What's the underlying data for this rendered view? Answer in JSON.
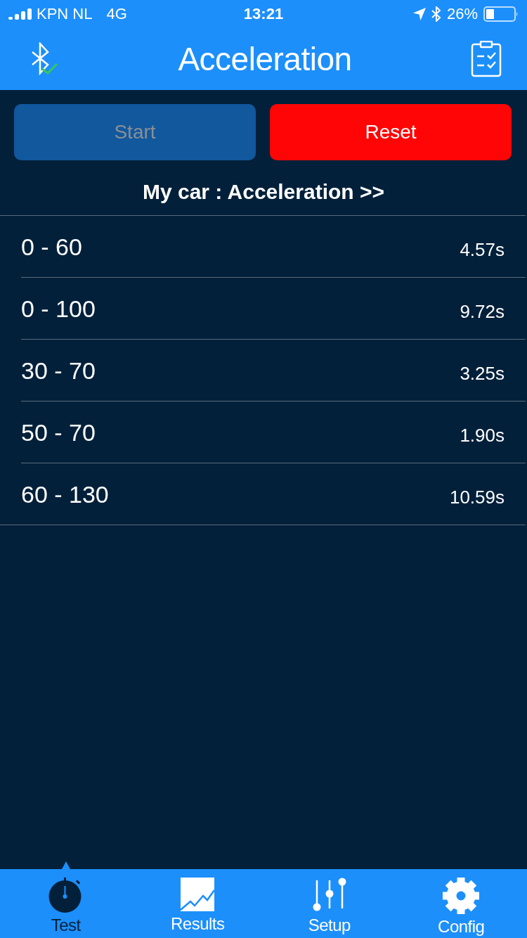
{
  "status_bar": {
    "carrier": "KPN NL",
    "network": "4G",
    "time": "13:21",
    "battery": "26%"
  },
  "nav_bar": {
    "title": "Acceleration",
    "bluetooth_connected": true
  },
  "buttons": [
    {
      "label": "Start",
      "kind": "start",
      "disabled": true
    },
    {
      "label": "Reset",
      "kind": "reset",
      "disabled": false
    }
  ],
  "subtitle": "My car : Acceleration >>",
  "results": [
    {
      "range": "0 - 60",
      "time": "4.57s"
    },
    {
      "range": "0 - 100",
      "time": "9.72s"
    },
    {
      "range": "30 - 70",
      "time": "3.25s"
    },
    {
      "range": "50 - 70",
      "time": "1.90s"
    },
    {
      "range": "60 - 130",
      "time": "10.59s"
    }
  ],
  "tabs": [
    {
      "label": "Test",
      "kind": "stopwatch",
      "selected": true
    },
    {
      "label": "Results",
      "kind": "chart",
      "selected": false
    },
    {
      "label": "Setup",
      "kind": "sliders",
      "selected": false
    },
    {
      "label": "Config",
      "kind": "gear",
      "selected": false
    }
  ]
}
